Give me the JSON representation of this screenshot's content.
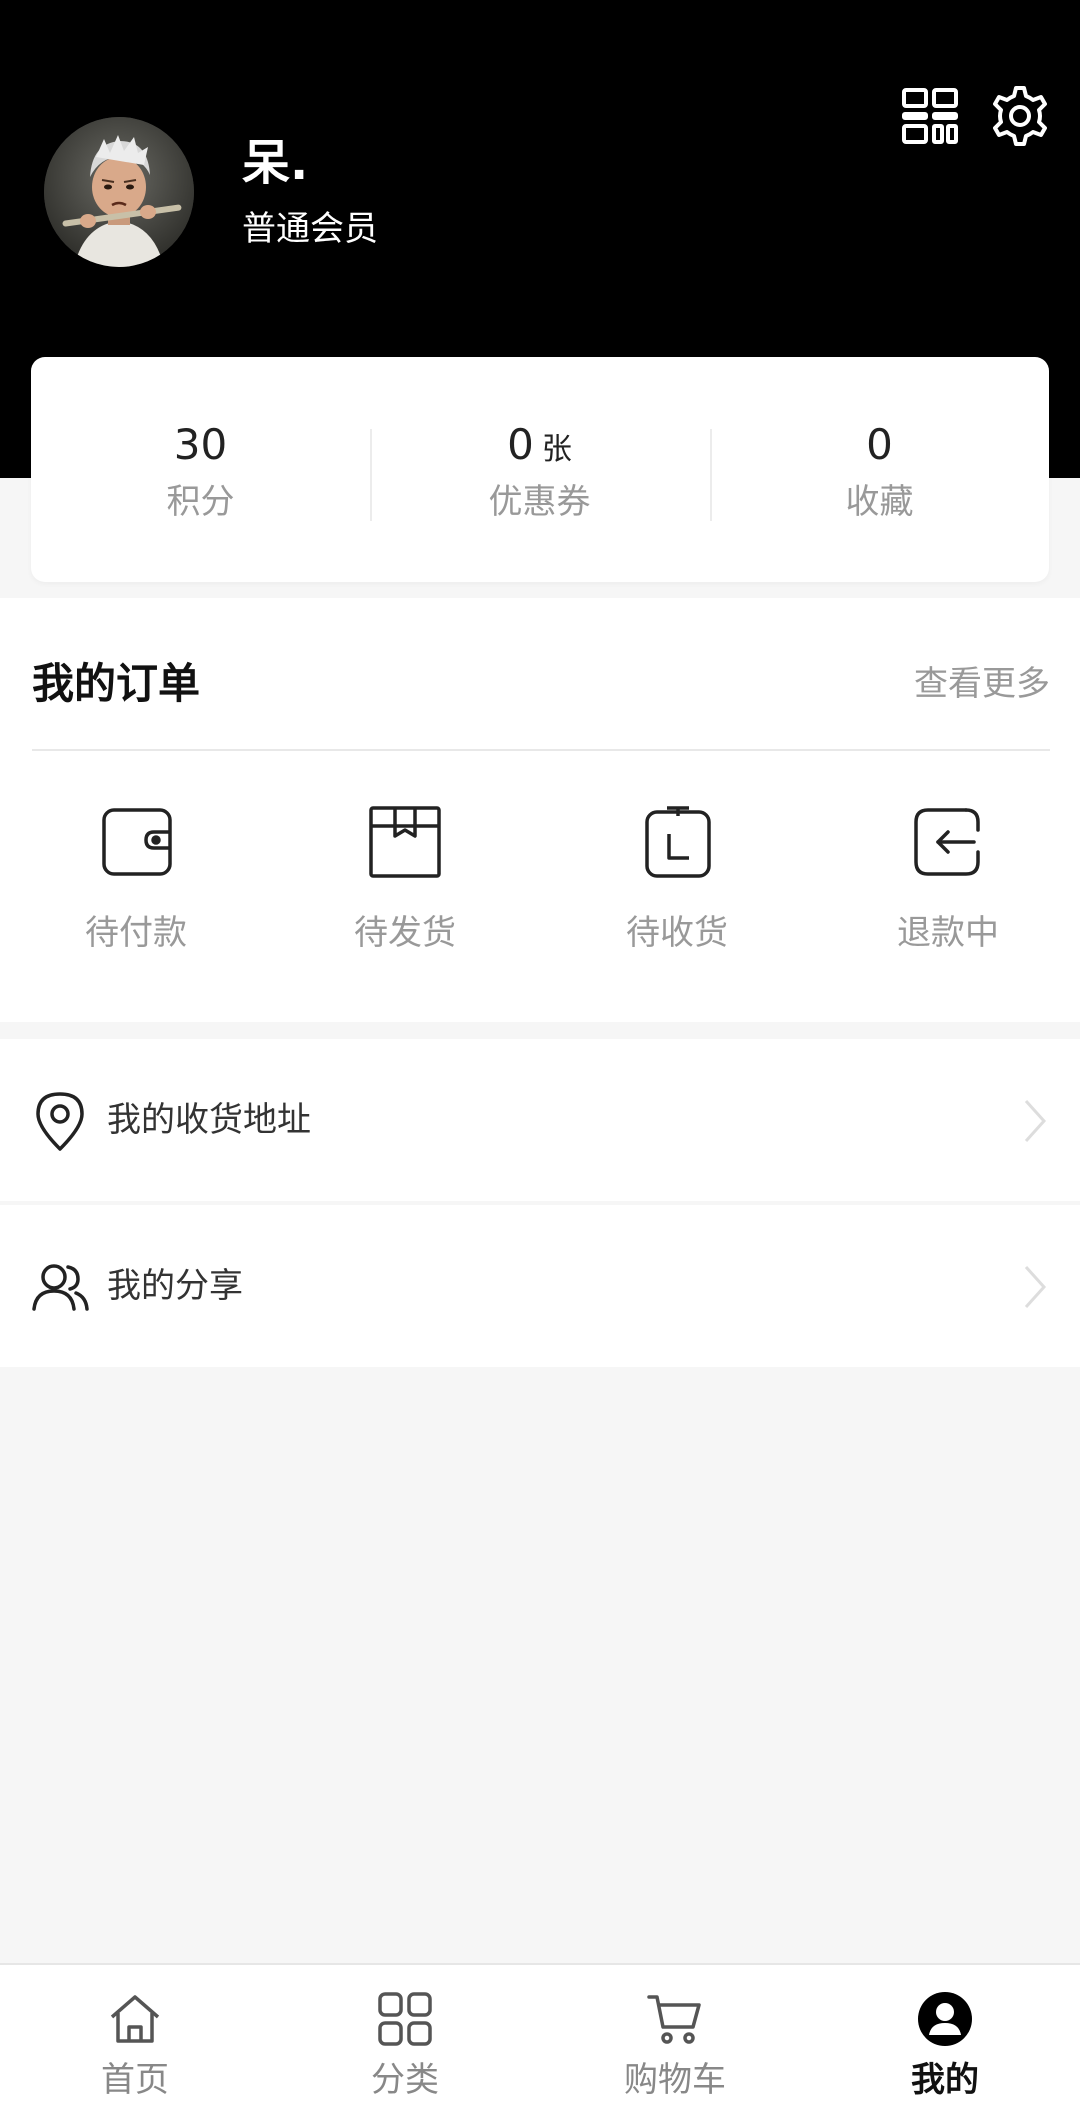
{
  "profile": {
    "name": "呆.",
    "level": "普通会员"
  },
  "stats": [
    {
      "value": "30",
      "unit": "",
      "label": "积分"
    },
    {
      "value": "0",
      "unit": "张",
      "label": "优惠券"
    },
    {
      "value": "0",
      "unit": "",
      "label": "收藏"
    }
  ],
  "orders": {
    "title": "我的订单",
    "more": "查看更多",
    "items": [
      {
        "label": "待付款",
        "icon": "wallet-icon"
      },
      {
        "label": "待发货",
        "icon": "package-icon"
      },
      {
        "label": "待收货",
        "icon": "clipboard-icon"
      },
      {
        "label": "退款中",
        "icon": "return-icon"
      }
    ]
  },
  "menu": [
    {
      "label": "我的收货地址",
      "icon": "location-pin-icon"
    },
    {
      "label": "我的分享",
      "icon": "users-icon"
    }
  ],
  "tabs": [
    {
      "label": "首页",
      "icon": "home-icon"
    },
    {
      "label": "分类",
      "icon": "grid-icon"
    },
    {
      "label": "购物车",
      "icon": "cart-icon"
    },
    {
      "label": "我的",
      "icon": "user-icon"
    }
  ],
  "active_tab": "我的",
  "colors": {
    "header_bg": "#000000",
    "page_bg": "#f6f6f6",
    "muted_text": "#999999"
  }
}
